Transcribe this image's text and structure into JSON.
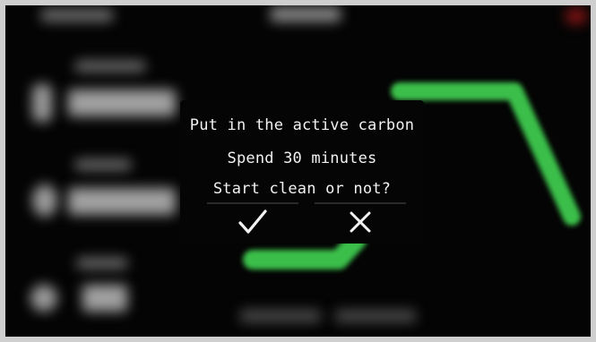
{
  "dialog": {
    "line1": "Put in the active carbon",
    "line2": "Spend 30 minutes",
    "line3": "Start clean or not?",
    "confirm_icon": "checkmark-icon",
    "cancel_icon": "close-icon"
  },
  "colors": {
    "screen_background": "#040404",
    "text": "#f2f2f2",
    "graph_green": "#3bbf4a",
    "alert_red": "#8a1515"
  }
}
